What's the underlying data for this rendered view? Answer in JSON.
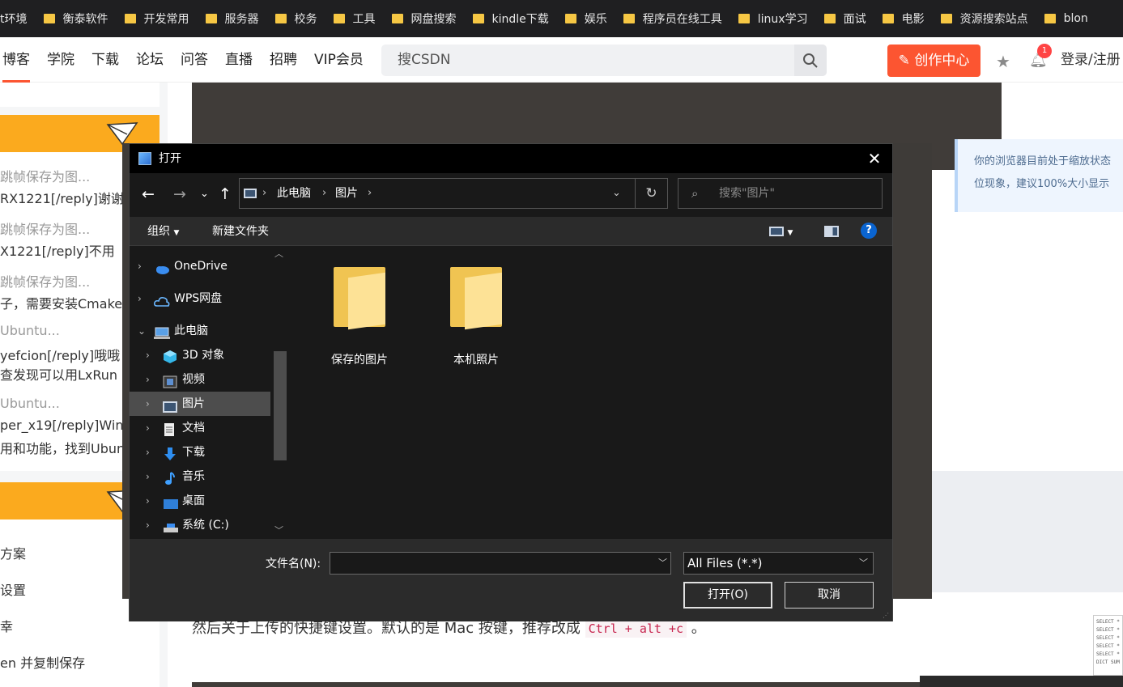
{
  "bookmarks": [
    "t环境",
    "衡泰软件",
    "开发常用",
    "服务器",
    "校务",
    "工具",
    "网盘搜索",
    "kindle下载",
    "娱乐",
    "程序员在线工具",
    "linux学习",
    "面试",
    "电影",
    "资源搜索站点",
    "blon"
  ],
  "nav": {
    "links": [
      "博客",
      "学院",
      "下载",
      "论坛",
      "问答",
      "直播",
      "招聘",
      "VIP会员"
    ],
    "search_placeholder": "搜CSDN",
    "create_label": "创作中心",
    "notification_count": "1",
    "login_label": "登录/注册"
  },
  "left_comments": [
    "跳帧保存为图...",
    "RX1221[/reply]谢谢",
    "跳帧保存为图...",
    "X1221[/reply]不用",
    "跳帧保存为图...",
    "子，需要安装Cmake",
    "Ubuntu...",
    "yefcion[/reply]哦哦",
    "查发现可以用LxRun",
    "Ubuntu...",
    "per_x19[/reply]Win",
    "用和功能，找到Ubun"
  ],
  "left_items": [
    "方案",
    "设置",
    "幸",
    "en 并复制保存"
  ],
  "notice": {
    "line1": "你的浏览器目前处于缩放状态",
    "line2": "位现象，建议100%大小显示"
  },
  "paragraph": {
    "before": "然后关于上传的快捷键设置。默认的是 Mac 按键，推荐改成 ",
    "code": "Ctrl + alt +c",
    "after": " 。"
  },
  "thumb_text": "SELECT * SELECT * SELECT * SELECT * SELECT * DICT SUM",
  "dialog": {
    "title": "打开",
    "crumbs": [
      "此电脑",
      "图片"
    ],
    "search_placeholder": "搜索\"图片\"",
    "toolbar": {
      "organize": "组织",
      "new_folder": "新建文件夹",
      "help": "?"
    },
    "tree": [
      {
        "label": "OneDrive",
        "level": 0,
        "expanded": false,
        "selected": false,
        "icon": "cloud-icon"
      },
      {
        "label": "WPS网盘",
        "level": 0,
        "expanded": false,
        "selected": false,
        "icon": "wps-cloud-icon"
      },
      {
        "label": "此电脑",
        "level": 0,
        "expanded": true,
        "selected": false,
        "icon": "computer-icon"
      },
      {
        "label": "3D 对象",
        "level": 1,
        "expanded": false,
        "selected": false,
        "icon": "3d-objects-icon"
      },
      {
        "label": "视频",
        "level": 1,
        "expanded": false,
        "selected": false,
        "icon": "video-icon"
      },
      {
        "label": "图片",
        "level": 1,
        "expanded": false,
        "selected": true,
        "icon": "pictures-icon"
      },
      {
        "label": "文档",
        "level": 1,
        "expanded": false,
        "selected": false,
        "icon": "documents-icon"
      },
      {
        "label": "下载",
        "level": 1,
        "expanded": false,
        "selected": false,
        "icon": "download-icon"
      },
      {
        "label": "音乐",
        "level": 1,
        "expanded": false,
        "selected": false,
        "icon": "music-icon"
      },
      {
        "label": "桌面",
        "level": 1,
        "expanded": false,
        "selected": false,
        "icon": "desktop-icon"
      },
      {
        "label": "系统 (C:)",
        "level": 1,
        "expanded": false,
        "selected": false,
        "icon": "drive-icon"
      }
    ],
    "folders": [
      "保存的图片",
      "本机照片"
    ],
    "filename_label": "文件名(N):",
    "filename_value": "",
    "filetype": "All Files (*.*)",
    "open_label": "打开(O)",
    "cancel_label": "取消"
  }
}
